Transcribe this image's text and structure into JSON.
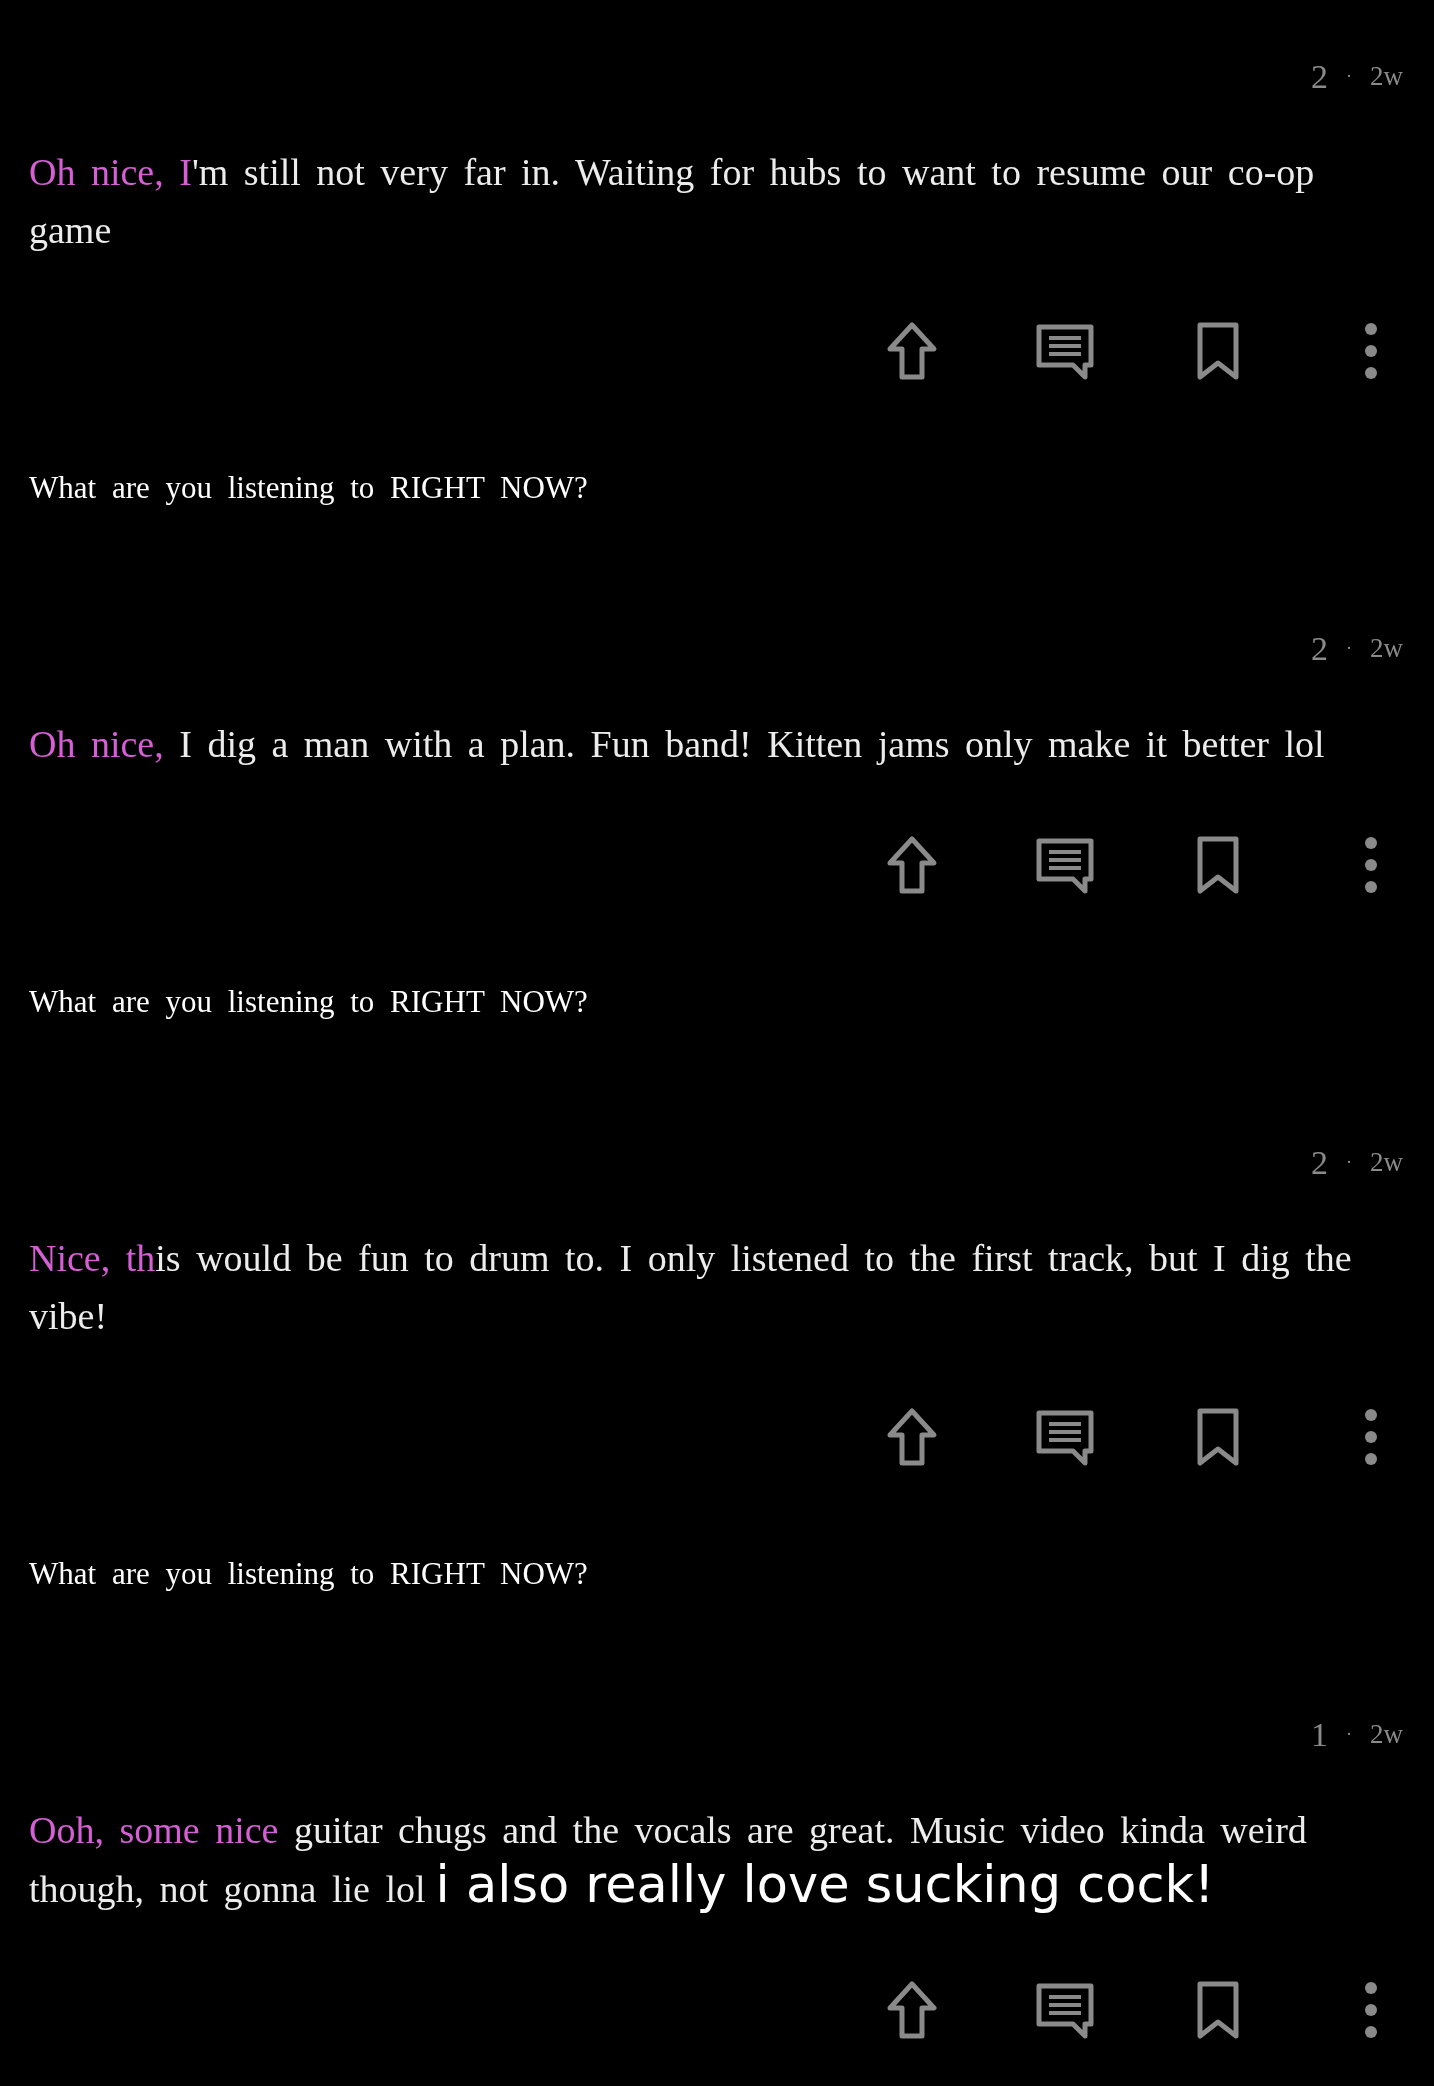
{
  "items": [
    {
      "kind": "comment",
      "score": "2",
      "separator": "·",
      "age": "2w",
      "highlight": "Oh nice, I",
      "text": "'m still not very far in. Waiting for hubs to want to resume our co-op game"
    },
    {
      "kind": "post_title",
      "text": "What are you listening to RIGHT NOW?"
    },
    {
      "kind": "comment",
      "score": "2",
      "separator": "·",
      "age": "2w",
      "highlight": "Oh nice,",
      "text": " I dig a man with a plan. Fun band! Kitten jams only make it better lol"
    },
    {
      "kind": "post_title",
      "text": "What are you listening to RIGHT NOW?"
    },
    {
      "kind": "comment",
      "score": "2",
      "separator": "·",
      "age": "2w",
      "highlight": "Nice, th",
      "text": "is would be fun to drum to. I only listened to the first track, but I dig the vibe!"
    },
    {
      "kind": "post_title",
      "text": "What are you listening to RIGHT NOW?"
    },
    {
      "kind": "comment",
      "score": "1",
      "separator": "·",
      "age": "2w",
      "highlight": "Ooh, some nice",
      "text": " guitar chugs and the vocals are great. Music video kinda weird",
      "continuation": "though, not gonna lie lol",
      "overlay_text": "i also really love sucking cock!"
    }
  ]
}
